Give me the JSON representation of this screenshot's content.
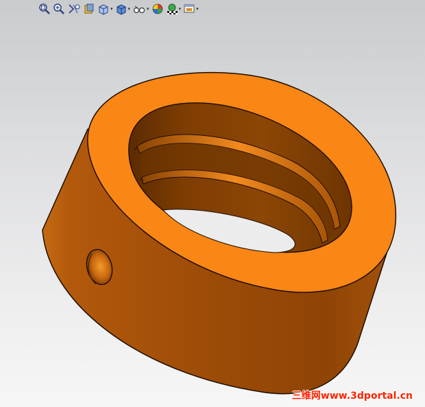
{
  "toolbar": {
    "buttons": [
      {
        "id": "zoom-to-fit",
        "icon": "zoom-to-fit-icon",
        "has_menu": false
      },
      {
        "id": "zoom-to-area",
        "icon": "zoom-to-area-icon",
        "has_menu": false
      },
      {
        "id": "previous-view",
        "icon": "previous-view-icon",
        "has_menu": false
      },
      {
        "id": "section-view",
        "icon": "section-view-icon",
        "has_menu": false
      },
      {
        "id": "view-orientation",
        "icon": "view-orientation-icon",
        "has_menu": true
      },
      {
        "id": "display-style",
        "icon": "display-style-icon",
        "has_menu": true
      },
      {
        "id": "hide-show-items",
        "icon": "hide-show-items-icon",
        "has_menu": true
      },
      {
        "id": "edit-appearance",
        "icon": "edit-appearance-icon",
        "has_menu": false
      },
      {
        "id": "apply-scene",
        "icon": "apply-scene-icon",
        "has_menu": true
      },
      {
        "id": "view-settings",
        "icon": "view-settings-icon",
        "has_menu": true
      }
    ],
    "menu_arrow": "▾"
  },
  "colors": {
    "background_top": "#c9cbcd",
    "background_bottom": "#f6f6f6",
    "part_face": "#f98615",
    "part_side_light": "#c1610a",
    "part_side_dark": "#7a3a02",
    "edge": "#1a0c00",
    "watermark": "#ff2200"
  },
  "watermark": {
    "text": "三维网www.3dportal.cn"
  }
}
